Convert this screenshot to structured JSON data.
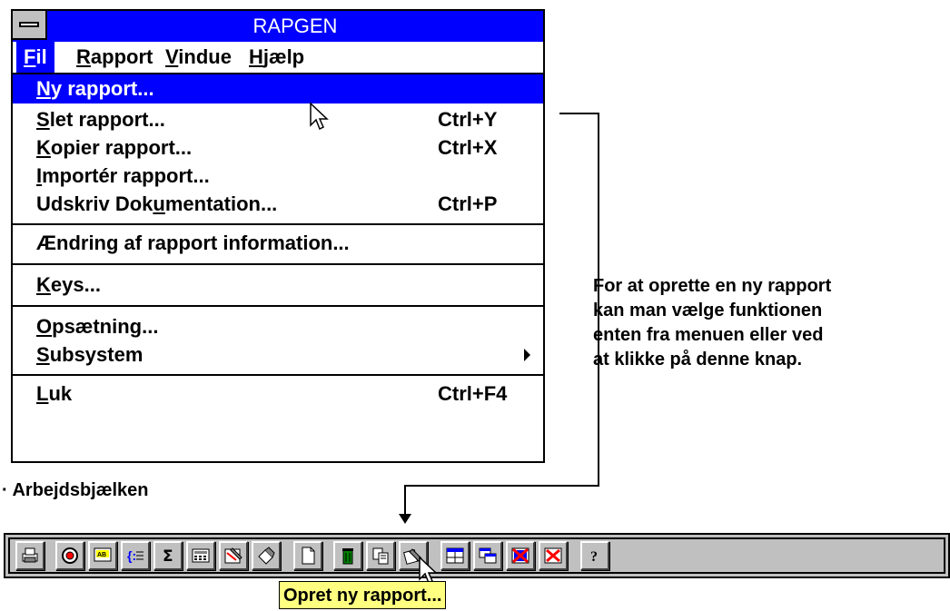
{
  "window": {
    "title": "RAPGEN"
  },
  "menubar": [
    {
      "pre": "",
      "key": "F",
      "post": "il"
    },
    {
      "pre": "",
      "key": "R",
      "post": "apport"
    },
    {
      "pre": "",
      "key": "V",
      "post": "indue"
    },
    {
      "pre": "",
      "key": "H",
      "post": "jælp"
    }
  ],
  "menu": {
    "items": [
      {
        "pre": "",
        "key": "N",
        "post": "y rapport...",
        "shortcut": ""
      },
      {
        "pre": "",
        "key": "S",
        "post": "let rapport...",
        "shortcut": "Ctrl+Y"
      },
      {
        "pre": "",
        "key": "K",
        "post": "opier rapport...",
        "shortcut": "Ctrl+X"
      },
      {
        "pre": "",
        "key": "I",
        "post": "mportér rapport...",
        "shortcut": ""
      },
      {
        "pre": "Udskriv Dok",
        "key": "u",
        "post": "mentation...",
        "shortcut": "Ctrl+P"
      },
      {
        "pre": "Ændring af rapport information...",
        "key": "",
        "post": "",
        "shortcut": ""
      },
      {
        "pre": "",
        "key": "K",
        "post": "eys...",
        "shortcut": ""
      },
      {
        "pre": "",
        "key": "O",
        "post": "psætning...",
        "shortcut": ""
      },
      {
        "pre": "",
        "key": "S",
        "post": "ubsystem",
        "shortcut": ""
      },
      {
        "pre": "",
        "key": "L",
        "post": "uk",
        "shortcut": "Ctrl+F4"
      }
    ]
  },
  "callout": {
    "lines": [
      "For at oprette en ny rapport",
      "kan man vælge funktionen",
      "enten fra menuen eller ved",
      "at klikke på denne knap."
    ]
  },
  "toolbar": {
    "label": "· Arbejdsbjælken",
    "buttons": [
      "printer-icon",
      "report-wheel-icon",
      "ab-text-icon",
      "brace-field-icon",
      "sum-icon",
      "calculator-icon",
      "edit-report-icon",
      "pen-icon",
      "new-document-icon",
      "trash-icon",
      "copy-icon",
      "import-icon",
      "layout-icon",
      "windows-icon",
      "delete-field-icon",
      "close-field-icon",
      "help-icon"
    ]
  },
  "tooltip": {
    "text": "Opret ny rapport..."
  },
  "colors": {
    "titlebar": "#0000ff",
    "highlight": "#0000ff",
    "toolbar": "#c0c0c0",
    "tooltip": "#ffff80"
  }
}
